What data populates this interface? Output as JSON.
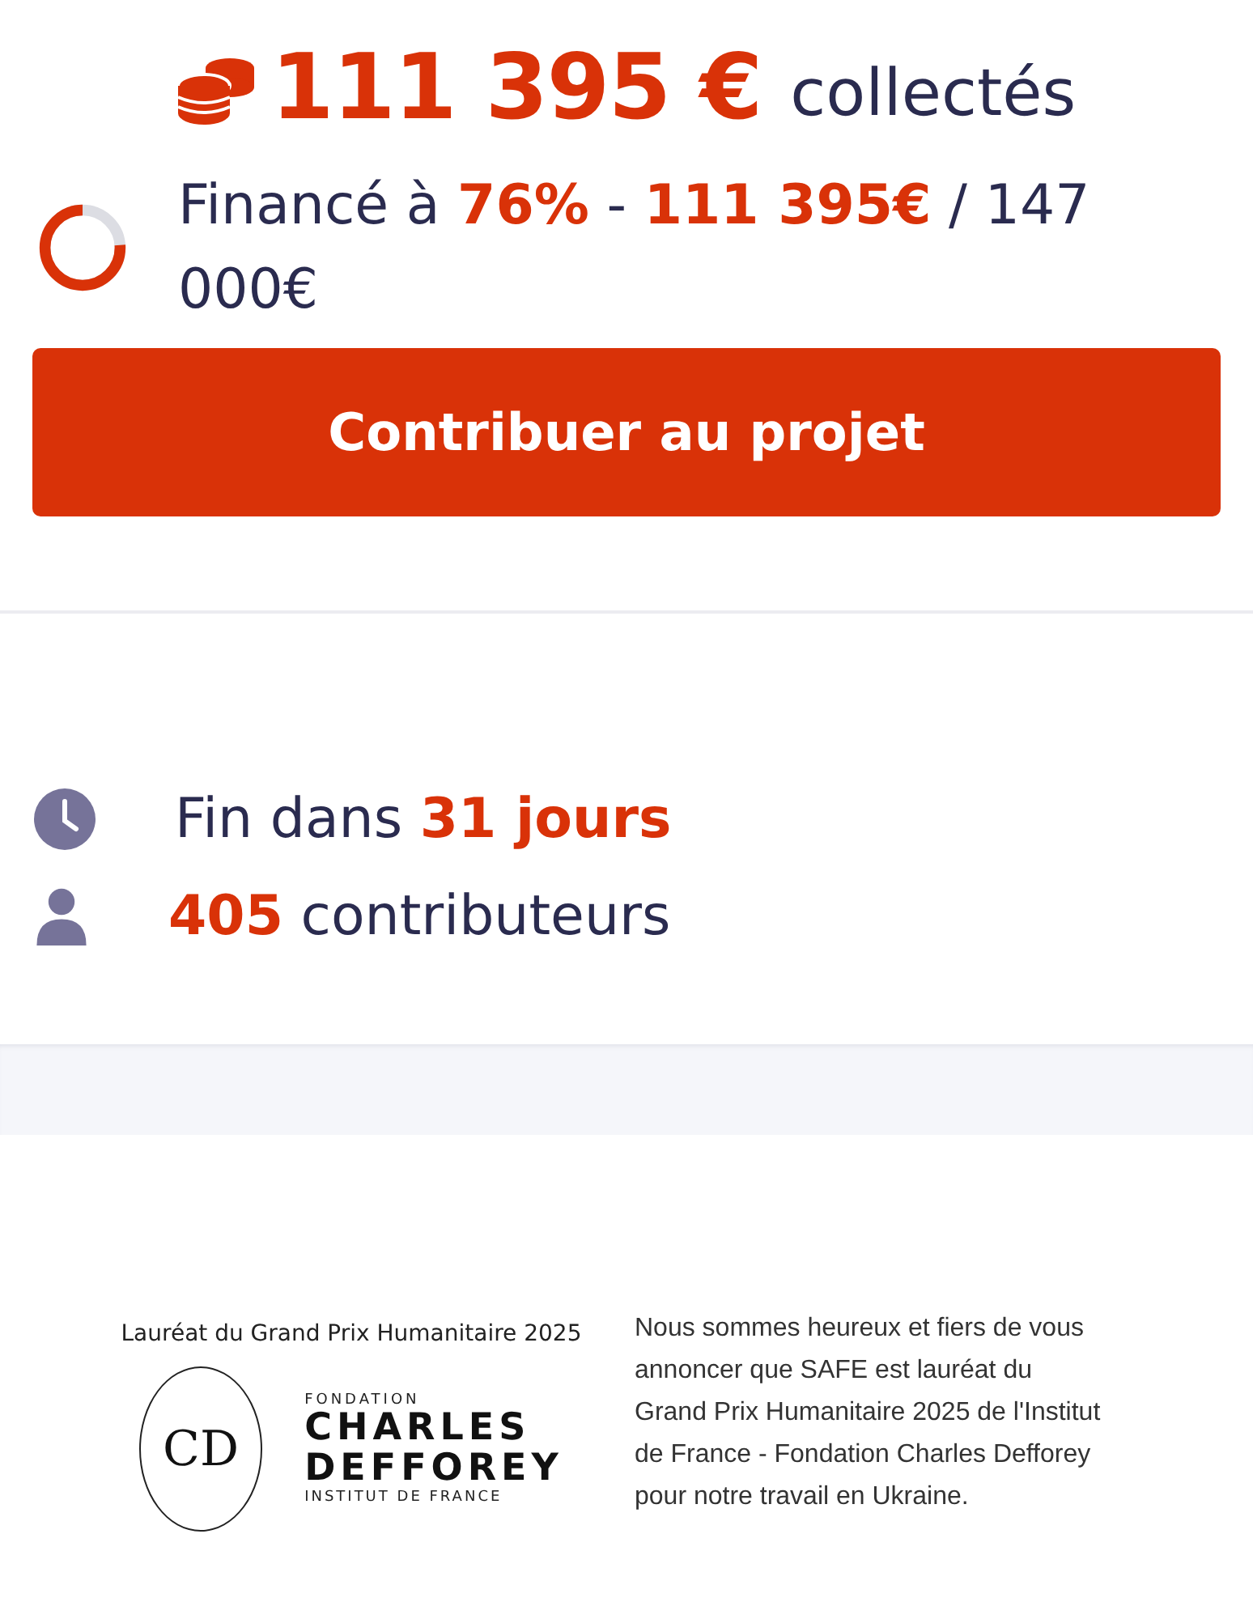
{
  "total": {
    "amount": "111 395 €",
    "label": "collectés"
  },
  "funding": {
    "text": "Financé à **76%** - **111 395€** / 147 000€"
  },
  "contribute_button": "Contribuer au projet",
  "stats": [
    {
      "kind": "time",
      "text": "Fin dans **31 jours**"
    },
    {
      "kind": "people",
      "text": "**405** contributeurs"
    }
  ],
  "award": {
    "caption": "Lauréat du Grand Prix Humanitaire 2025",
    "logo": {
      "monogram": "CD",
      "overline": "FONDATION",
      "name_lines": [
        "CHARLES",
        "DEFFOREY"
      ],
      "subline": "INSTITUT DE FRANCE"
    },
    "description": "Nous sommes heureux et fiers de vous annoncer que SAFE est lauréat du Grand Prix Humanitaire 2025 de l'Institut de France - Fondation Charles Defforey pour notre travail en Ukraine."
  }
}
